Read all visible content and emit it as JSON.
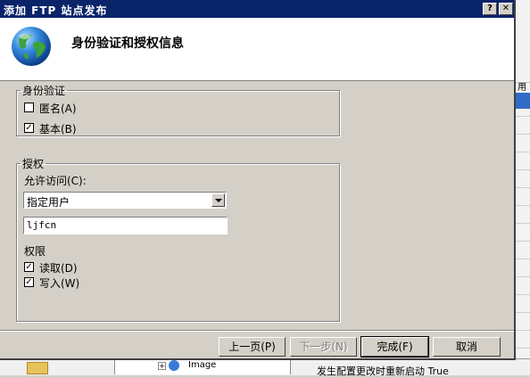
{
  "window": {
    "title": "添加 FTP 站点发布"
  },
  "header": {
    "title": "身份验证和授权信息"
  },
  "authentication": {
    "legend": "身份验证",
    "anonymous": {
      "label": "匿名(A)",
      "checked": false
    },
    "basic": {
      "label": "基本(B)",
      "checked": true
    }
  },
  "authorization": {
    "legend": "授权",
    "allow_label": "允许访问(C):",
    "allow_value": "指定用户",
    "user_value": "ljfcn",
    "permissions_label": "权限",
    "read": {
      "label": "读取(D)",
      "checked": true
    },
    "write": {
      "label": "写入(W)",
      "checked": true
    }
  },
  "buttons": {
    "prev": "上一页(P)",
    "next": "下一步(N)",
    "finish": "完成(F)",
    "cancel": "取消"
  },
  "background": {
    "column_header_fragment": "用",
    "tree_item": "Image",
    "status_text": "发生配置更改时重新启动  True"
  },
  "colors": {
    "titlebar": "#0a246a",
    "face": "#d4d0c8",
    "selection": "#316ac5"
  }
}
